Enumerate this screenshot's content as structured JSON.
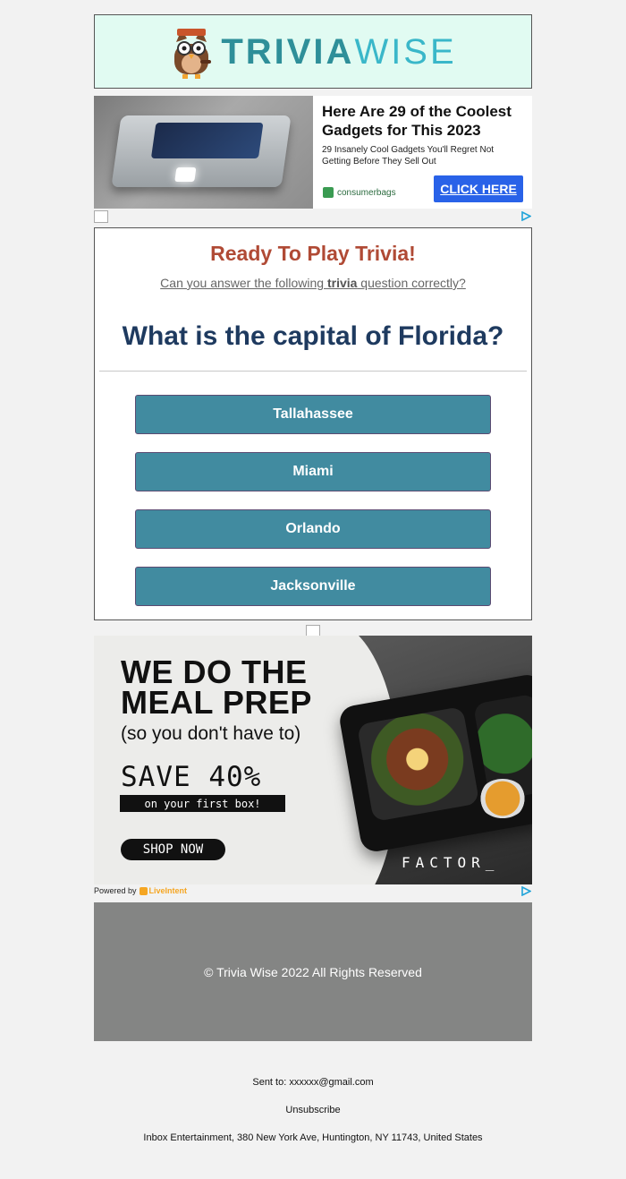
{
  "header": {
    "logo_part1": "TRIVIA",
    "logo_part2": "WISE",
    "logo_icon": "owl-mascot-icon"
  },
  "ad_top": {
    "title": "Here Are 29 of the Coolest Gadgets for This 2023",
    "subtitle": "29 Insanely Cool Gadgets You'll Regret Not Getting Before They Sell Out",
    "brand": "consumerbags",
    "cta": "CLICK HERE",
    "cta_color": "#2962e8"
  },
  "trivia": {
    "heading": "Ready To Play Trivia!",
    "prompt_before": "Can you answer the following ",
    "prompt_bold": "trivia",
    "prompt_after": " question correctly?",
    "question": "What is the capital of Florida?",
    "answers": [
      "Tallahassee",
      "Miami",
      "Orlando",
      "Jacksonville"
    ],
    "answer_color": "#418ba0",
    "heading_color": "#b04a35",
    "question_color": "#1e3a5f"
  },
  "ad_bottom": {
    "headline_line1": "WE DO THE",
    "headline_line2": "MEAL PREP",
    "tagline": "(so you don't have to)",
    "discount": "SAVE 40%",
    "discount_note": "on your first box!",
    "cta": "SHOP NOW",
    "brand": "FACTOR_",
    "powered_by": "Powered by",
    "powered_brand": "LiveIntent"
  },
  "footer": {
    "copyright": "© Trivia Wise 2022 All Rights Reserved",
    "sent_to_label": "Sent to: ",
    "sent_to_email": "xxxxxx@gmail.com",
    "unsubscribe": "Unsubscribe",
    "address": "Inbox Entertainment, 380 New York Ave, Huntington, NY 11743, United States"
  }
}
